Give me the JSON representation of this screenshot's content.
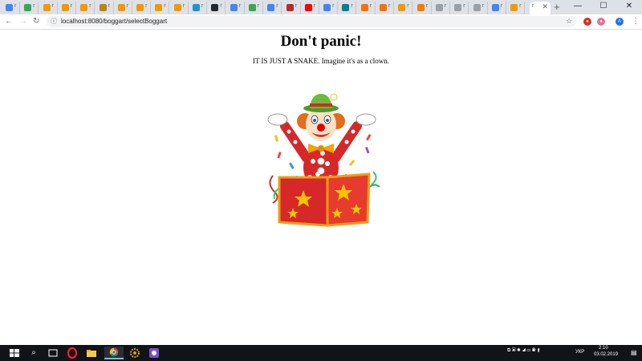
{
  "browser": {
    "tabs": [
      {
        "favicon": "google-g",
        "color": "#4285f4"
      },
      {
        "favicon": "green-leaf",
        "color": "#34a853"
      },
      {
        "favicon": "orange-figure",
        "color": "#f29900"
      },
      {
        "favicon": "orange-figure",
        "color": "#f29900"
      },
      {
        "favicon": "orange-figure",
        "color": "#f29900"
      },
      {
        "favicon": "gold-emblem",
        "color": "#b8860b"
      },
      {
        "favicon": "orange-figure",
        "color": "#f29900"
      },
      {
        "favicon": "orange-figure",
        "color": "#f29900"
      },
      {
        "favicon": "orange-figure",
        "color": "#f29900"
      },
      {
        "favicon": "orange-figure",
        "color": "#f29900"
      },
      {
        "favicon": "blue-telegram",
        "color": "#1e96c8"
      },
      {
        "favicon": "github",
        "color": "#24292e"
      },
      {
        "favicon": "google-g",
        "color": "#4285f4"
      },
      {
        "favicon": "green-square",
        "color": "#3aa757"
      },
      {
        "favicon": "google-g",
        "color": "#4285f4"
      },
      {
        "favicon": "red-q",
        "color": "#b92b27"
      },
      {
        "favicon": "yandex-y",
        "color": "#ff0000"
      },
      {
        "favicon": "google-g",
        "color": "#4285f4"
      },
      {
        "favicon": "teal-icon",
        "color": "#00838f"
      },
      {
        "favicon": "orange-h",
        "color": "#ff6f00"
      },
      {
        "favicon": "orange-h",
        "color": "#ff6f00"
      },
      {
        "favicon": "orange-figure",
        "color": "#f29900"
      },
      {
        "favicon": "orange-t",
        "color": "#f57c00"
      },
      {
        "favicon": "document",
        "color": "#9aa0a6"
      },
      {
        "favicon": "document",
        "color": "#9aa0a6"
      },
      {
        "favicon": "document",
        "color": "#9aa0a6"
      },
      {
        "favicon": "google-g",
        "color": "#4285f4"
      },
      {
        "favicon": "orange-figure",
        "color": "#f29900"
      }
    ],
    "tab_char": "r",
    "active_tab_char": "r",
    "url": "localhost:8080/boggart/selectBoggart",
    "avatar_letter": "A"
  },
  "page": {
    "title": "Don't panic!",
    "subtitle": "IT IS JUST A SNAKE. Imagine it's as a clown."
  },
  "taskbar": {
    "lang": "УКР",
    "time": "2:10",
    "date": "03.02.2019"
  }
}
